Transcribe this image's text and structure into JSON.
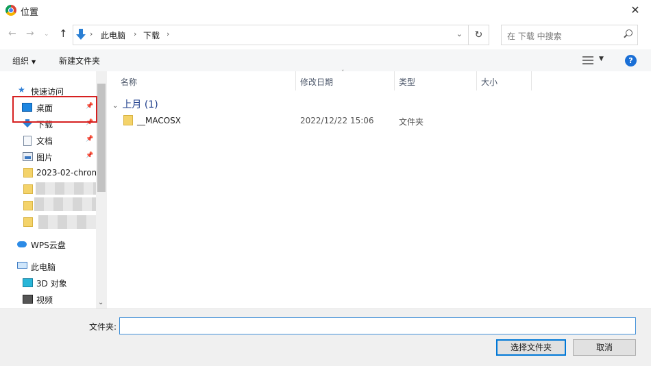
{
  "window": {
    "title": "位置",
    "close_glyph": "✕"
  },
  "nav": {
    "back_glyph": "←",
    "forward_glyph": "→",
    "recent_glyph": "⌄",
    "up_glyph": "↑",
    "crumbs": [
      "此电脑",
      "下载"
    ],
    "separator": "›",
    "chevron_glyph": "⌄",
    "refresh_glyph": "↻",
    "search_placeholder": "在 下载 中搜索"
  },
  "toolbar": {
    "organize_label": "组织",
    "organize_arrow": "▼",
    "new_folder_label": "新建文件夹",
    "view_arrow": "▼",
    "help_glyph": "?"
  },
  "sidebar": {
    "quick_access": "快速访问",
    "star_glyph": "★",
    "pin_glyph": "📌",
    "items": [
      {
        "label": "桌面",
        "icon": "desktop-icon",
        "pinned": true
      },
      {
        "label": "下载",
        "icon": "download-icon",
        "pinned": true
      },
      {
        "label": "文档",
        "icon": "document-icon",
        "pinned": true
      },
      {
        "label": "图片",
        "icon": "picture-icon",
        "pinned": true
      },
      {
        "label": "2023-02-chrom",
        "icon": "folder-icon",
        "pinned": false
      }
    ],
    "wps_cloud": "WPS云盘",
    "this_pc": "此电脑",
    "pc_items": [
      {
        "label": "3D 对象",
        "icon": "3d-objects-icon"
      },
      {
        "label": "视频",
        "icon": "video-icon"
      }
    ],
    "scroll_down_glyph": "⌄"
  },
  "file_list": {
    "columns": [
      "名称",
      "修改日期",
      "类型",
      "大小"
    ],
    "sort_glyph": "ˇ",
    "group": {
      "label": "上月 (1)",
      "chevron": "⌄"
    },
    "rows": [
      {
        "name": "__MACOSX",
        "modified": "2022/12/22 15:06",
        "type": "文件夹",
        "size": ""
      }
    ]
  },
  "footer": {
    "folder_label": "文件夹:",
    "folder_value": "",
    "select_button": "选择文件夹",
    "cancel_button": "取消"
  },
  "colors": {
    "accent": "#0078d7",
    "highlight_border": "#d62020",
    "group_text": "#1e3e8c"
  }
}
